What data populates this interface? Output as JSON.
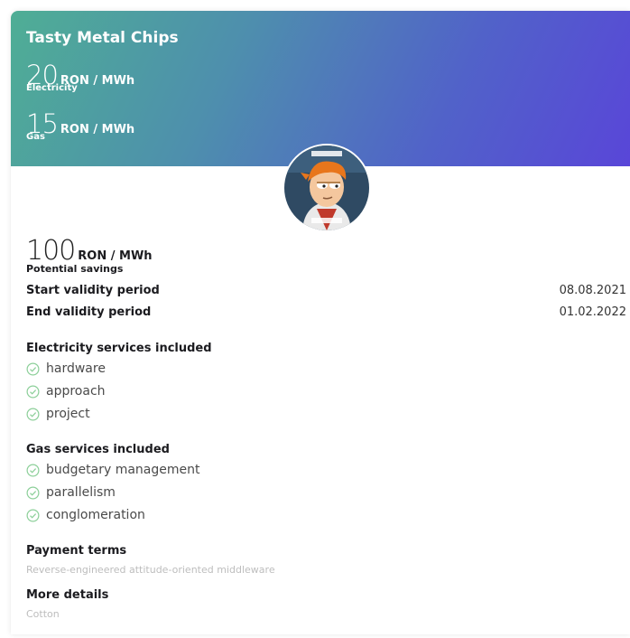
{
  "card": {
    "title": "Tasty Metal Chips",
    "prices": [
      {
        "value": "20",
        "unit": "RON / MWh",
        "label": "Electricity"
      },
      {
        "value": "15",
        "unit": "RON / MWh",
        "label": "Gas"
      }
    ],
    "savings": {
      "value": "100",
      "unit": "RON / MWh",
      "label": "Potential savings"
    },
    "validity": [
      {
        "label": "Start validity period",
        "value": "08.08.2021"
      },
      {
        "label": "End validity period",
        "value": "01.02.2022"
      }
    ],
    "electricity_services": {
      "title": "Electricity services included",
      "items": [
        "hardware",
        "approach",
        "project"
      ]
    },
    "gas_services": {
      "title": "Gas services included",
      "items": [
        "budgetary management",
        "parallelism",
        "conglomeration"
      ]
    },
    "payment_terms": {
      "title": "Payment terms",
      "value": "Reverse-engineered attitude-oriented middleware"
    },
    "more_details": {
      "title": "More details",
      "value": "Cotton"
    },
    "colors": {
      "gradient_start": "#4fae95",
      "gradient_end": "#5946d8",
      "check": "#8ccf99"
    },
    "avatar_icon": "fry-meme-avatar"
  }
}
